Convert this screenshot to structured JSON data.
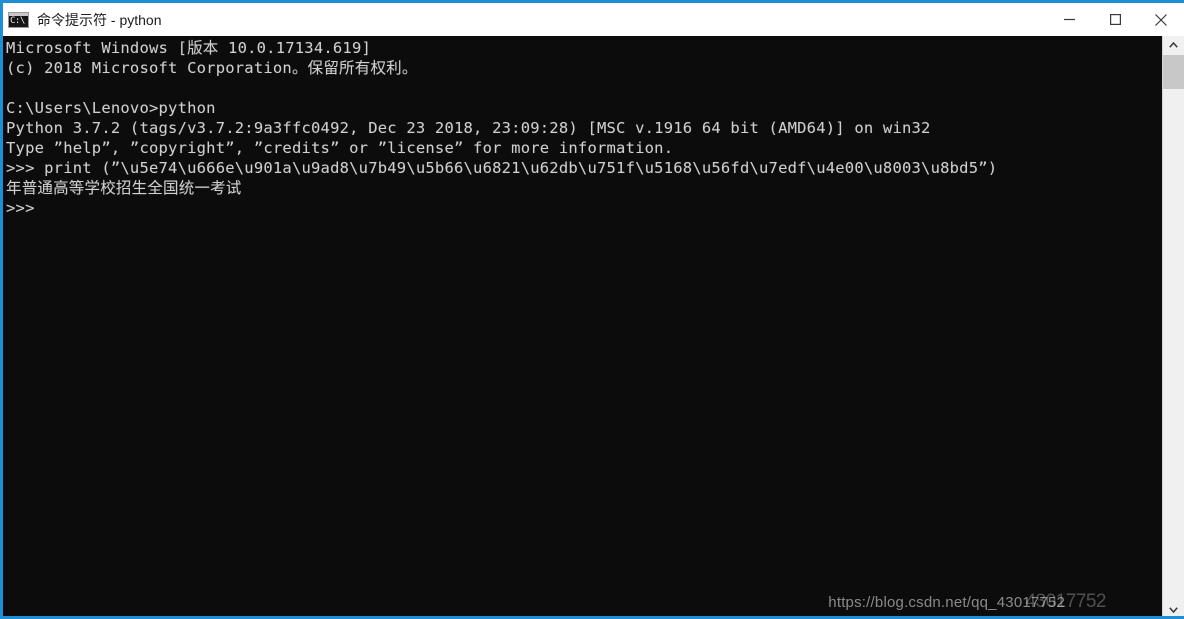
{
  "window": {
    "title": "命令提示符 - python",
    "icon": "cmd-icon",
    "icon_glyph": "C:\\",
    "accent_color": "#1e8fd5",
    "console_bg": "#0c0c0c",
    "console_fg": "#cfcfcf"
  },
  "titlebar": {
    "minimize_label": "—",
    "maximize_label": "□",
    "close_label": "✕"
  },
  "console": {
    "lines": [
      "Microsoft Windows [版本 10.0.17134.619]",
      "(c) 2018 Microsoft Corporation。保留所有权利。",
      "",
      "C:\\Users\\Lenovo>python",
      "Python 3.7.2 (tags/v3.7.2:9a3ffc0492, Dec 23 2018, 23:09:28) [MSC v.1916 64 bit (AMD64)] on win32",
      "Type ”help”, ”copyright”, ”credits” or ”license” for more information.",
      ">>> print (”\\u5e74\\u666e\\u901a\\u9ad8\\u7b49\\u5b66\\u6821\\u62db\\u751f\\u5168\\u56fd\\u7edf\\u4e00\\u8003\\u8bd5”)",
      "年普通高等学校招生全国统一考试",
      ">>>"
    ]
  },
  "watermark": {
    "text": "https://blog.csdn.net/qq_43017752",
    "overlay": "43017752"
  },
  "scrollbar": {
    "up_arrow": "⌃",
    "down_arrow": "⌄"
  }
}
